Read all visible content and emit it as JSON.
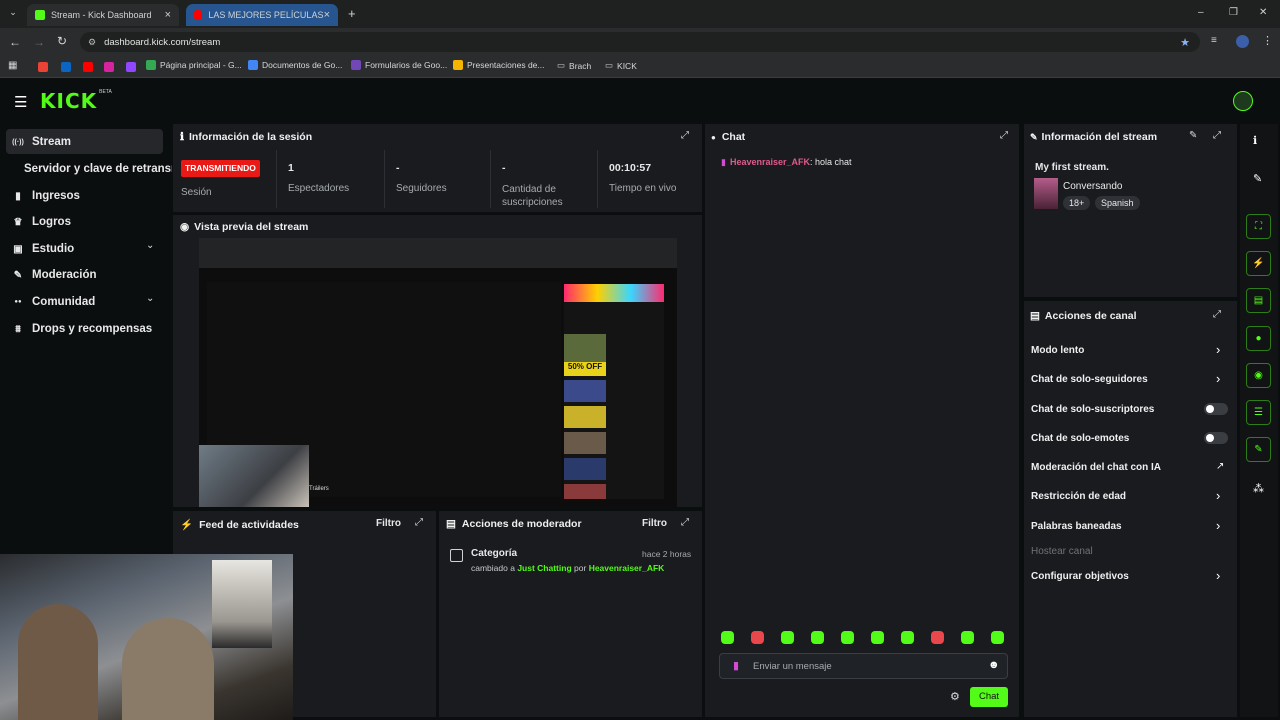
{
  "browser": {
    "tabs": [
      {
        "title": "Stream - Kick Dashboard",
        "close": "×"
      },
      {
        "title": "LAS MEJORES PELÍCULAS PRÓ",
        "close": "×"
      }
    ],
    "new_tab": "+",
    "url": "dashboard.kick.com/stream",
    "bookmarks": [
      "Página principal - G...",
      "Documentos de Go...",
      "Formularios de Goo...",
      "Presentaciones de...",
      "Brach",
      "KICK"
    ],
    "window_controls": [
      "–",
      "❐",
      "✕"
    ]
  },
  "app": {
    "logo": "KICK",
    "logo_badge": "BETA"
  },
  "sidebar": {
    "items": [
      {
        "label": "Stream",
        "icon": "((·))"
      },
      {
        "label": "Servidor y clave de retransmisión",
        "icon": ""
      },
      {
        "label": "Ingresos",
        "icon": "▮"
      },
      {
        "label": "Logros",
        "icon": "♛"
      },
      {
        "label": "Estudio",
        "icon": "▣",
        "caret": "⌄"
      },
      {
        "label": "Moderación",
        "icon": "🔧"
      },
      {
        "label": "Comunidad",
        "icon": "●●",
        "caret": "⌄"
      },
      {
        "label": "Drops y recompensas",
        "icon": "⩩"
      }
    ]
  },
  "session": {
    "title": "Información de la sesión",
    "status_badge": "TRANSMITIENDO",
    "status_label": "Sesión",
    "stats": [
      {
        "value": "1",
        "label": "Espectadores"
      },
      {
        "value": "-",
        "label": "Seguidores"
      },
      {
        "value": "-",
        "label": "Cantidad de suscripciones"
      },
      {
        "value": "00:10:57",
        "label": "Tiempo en vivo"
      }
    ]
  },
  "preview": {
    "title": "Vista previa del stream",
    "inner_banner": "50% OFF",
    "inner_caption": "Tráilers"
  },
  "activity": {
    "title": "Feed de actividades",
    "filter": "Filtro"
  },
  "mod_actions": {
    "title": "Acciones de moderador",
    "filter": "Filtro",
    "entry": {
      "title": "Categoría",
      "time": "hace 2 horas",
      "prefix": "cambiado a",
      "category": "Just Chatting",
      "by": "por",
      "user": "Heavenraiser_AFK"
    }
  },
  "chat": {
    "title": "Chat",
    "messages": [
      {
        "user": "Heavenraiser_AFK",
        "text": ": hola chat"
      }
    ],
    "placeholder": "Enviar un mensaje",
    "send": "Chat",
    "emote_colors": [
      "#53fc18",
      "#e8474c",
      "#53fc18",
      "#53fc18",
      "#53fc18",
      "#53fc18",
      "#53fc18",
      "#e8474c",
      "#53fc18",
      "#53fc18"
    ]
  },
  "stream_info": {
    "title": "Información del stream",
    "stream_title": "My first stream.",
    "category": "Conversando",
    "tags": [
      "18+",
      "Spanish"
    ]
  },
  "channel_actions": {
    "title": "Acciones de canal",
    "items": [
      {
        "label": "Modo lento",
        "control": "arrow"
      },
      {
        "label": "Chat de solo-seguidores",
        "control": "arrow"
      },
      {
        "label": "Chat de solo-suscriptores",
        "control": "toggle"
      },
      {
        "label": "Chat de solo-emotes",
        "control": "toggle"
      },
      {
        "label": "Moderación del chat con IA",
        "control": "external"
      },
      {
        "label": "Restricción de edad",
        "control": "arrow"
      },
      {
        "label": "Palabras baneadas",
        "control": "arrow"
      },
      {
        "label": "Hostear canal",
        "control": "disabled"
      },
      {
        "label": "Configurar objetivos",
        "control": "arrow"
      }
    ]
  },
  "colors": {
    "accent": "#53fc18",
    "live_badge": "#e91916",
    "panel": "#191b1f",
    "background": "#0b0e0f",
    "username": "#e05a8a"
  }
}
